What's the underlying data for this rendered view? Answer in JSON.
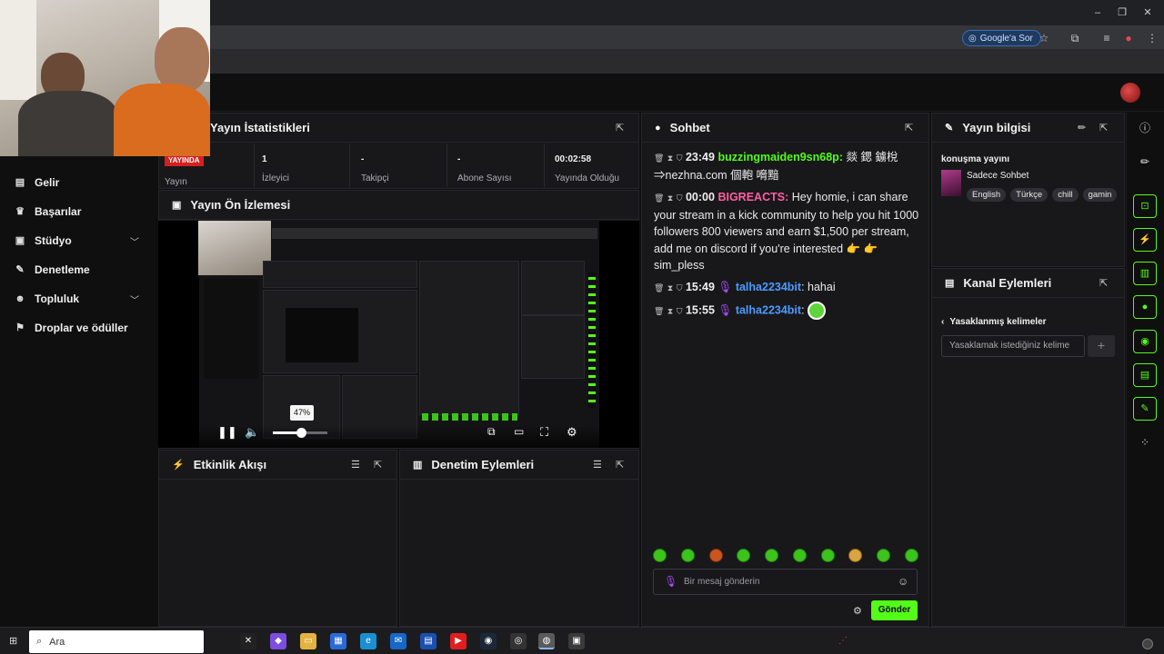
{
  "browser": {
    "google_chip": "Google'a Sor",
    "win_controls": [
      "–",
      "❐",
      "✕"
    ]
  },
  "nav": {
    "items": [
      {
        "label": "Gelir",
        "icon": "chart-icon",
        "has_chevron": false
      },
      {
        "label": "Başarılar",
        "icon": "trophy-icon",
        "has_chevron": false
      },
      {
        "label": "Stüdyo",
        "icon": "studio-icon",
        "has_chevron": true
      },
      {
        "label": "Denetleme",
        "icon": "wrench-icon",
        "has_chevron": false
      },
      {
        "label": "Topluluk",
        "icon": "community-icon",
        "has_chevron": true
      },
      {
        "label": "Droplar ve ödüller",
        "icon": "gift-icon",
        "has_chevron": false
      }
    ]
  },
  "stats": {
    "title": "Yayın İstatistikleri",
    "live_badge": "YAYINDA",
    "live_label": "Yayın",
    "cells": [
      {
        "value": "1",
        "label": "İzleyici"
      },
      {
        "value": "-",
        "label": "Takipçi"
      },
      {
        "value": "-",
        "label": "Abone Sayısı"
      },
      {
        "value": "00:02:58",
        "label": "Yayında Olduğu"
      }
    ]
  },
  "preview": {
    "title": "Yayın Ön İzlemesi",
    "volume_percent": 47,
    "volume_tip": "47%"
  },
  "activity": {
    "title": "Etkinlik Akışı"
  },
  "moderation": {
    "title": "Denetim Eylemleri"
  },
  "chat": {
    "title": "Sohbet",
    "messages": [
      {
        "time": "23:49",
        "user": "buzzingmaiden9sn68p",
        "user_color": "green",
        "text": "燚 鍶 鐪梲 ⇒nezhna.com 個軳 嗋黯"
      },
      {
        "time": "00:00",
        "user": "BIGREACTS",
        "user_color": "pink",
        "text": "Hey homie, i can share your stream in a kick community to help you hit 1000 followers 800 viewers and earn $1,500 per stream, add me on discord if you're interested 👉 👉 sim_pless"
      },
      {
        "time": "15:49",
        "user": "talha2234bit",
        "user_color": "blue",
        "text": "hahai"
      },
      {
        "time": "15:55",
        "user": "talha2234bit",
        "user_color": "blue",
        "text": ""
      }
    ],
    "input_placeholder": "Bir mesaj gönderin",
    "send_label": "Gönder"
  },
  "stream_info": {
    "title": "Yayın bilgisi",
    "stream_title": "konuşma yayını",
    "category": "Sadece Sohbet",
    "tags": [
      "English",
      "Türkçe",
      "chill",
      "gamin"
    ]
  },
  "channel_actions": {
    "title": "Kanal Eylemleri",
    "section_title": "Yasaklanmış kelimeler",
    "input_placeholder": "Yasaklamak istediğiniz kelime",
    "add_symbol": "+"
  },
  "taskbar": {
    "search_placeholder": "Ara"
  },
  "colors": {
    "accent": "#53fc18",
    "live_red": "#d61f1f",
    "bg": "#0f0f10",
    "panel": "#18181b"
  }
}
